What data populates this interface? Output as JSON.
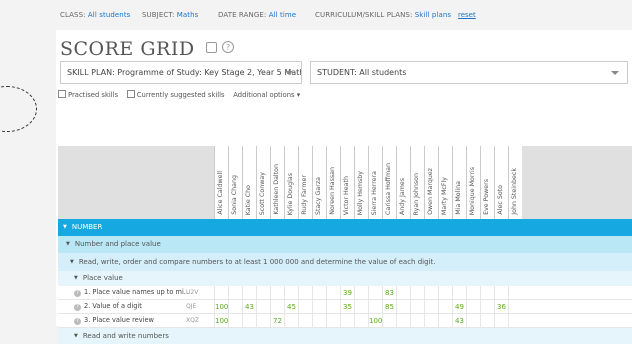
{
  "filters": {
    "class": {
      "label": "CLASS:",
      "value": "All students"
    },
    "subject": {
      "label": "SUBJECT:",
      "value": "Maths"
    },
    "date_range": {
      "label": "DATE RANGE:",
      "value": "All time"
    },
    "plans": {
      "label": "CURRICULUM/SKILL PLANS:",
      "value": "Skill plans"
    },
    "reset": "reset"
  },
  "title": "SCORE GRID",
  "title_icons": [
    "table-icon",
    "help-icon"
  ],
  "help_glyph": "?",
  "skill_plan_select": "SKILL PLAN: Programme of Study: Key Stage 2, Year 5 Math",
  "student_select": "STUDENT: All students",
  "options": {
    "practised": "Practised skills",
    "suggested": "Currently suggested skills",
    "additional": "Additional options"
  },
  "students": [
    "Alice Caldwell",
    "Sonia Chang",
    "Katie Cho",
    "Scott Conway",
    "Kathleen Dalton",
    "Kylie Douglas",
    "Rudy Farmer",
    "Stacy Garza",
    "Noreen Hassan",
    "Victor Heath",
    "Molly Hemsby",
    "Sierra Herrera",
    "Carissa Hoffman",
    "Andy James",
    "Ryan Johnson",
    "Owen Marquez",
    "Marty McFly",
    "Mia Molina",
    "Monique Morris",
    "Eve Powers",
    "Alec Soto",
    "John Steinbeck"
  ],
  "bands": {
    "number": "NUMBER",
    "npv": "Number and place value",
    "objective": "Read, write, order and compare numbers to at least 1 000 000 and determine the value of each digit.",
    "place_value": "Place value",
    "read_write": "Read and write numbers"
  },
  "skills": [
    {
      "name": "1. Place value names up to mi...",
      "code": "U2V",
      "scores": [
        "",
        "",
        "",
        "",
        "",
        "",
        "",
        "",
        "",
        "39",
        "",
        "",
        "83",
        "",
        "",
        "",
        "",
        "",
        "",
        "",
        "",
        ""
      ]
    },
    {
      "name": "2. Value of a digit",
      "code": "QJE",
      "scores": [
        "100",
        "",
        "43",
        "",
        "",
        "45",
        "",
        "",
        "",
        "35",
        "",
        "",
        "85",
        "",
        "",
        "",
        "",
        "49",
        "",
        "",
        "36",
        ""
      ]
    },
    {
      "name": "3. Place value review",
      "code": "XQZ",
      "scores": [
        "100",
        "",
        "",
        "",
        "72",
        "",
        "",
        "",
        "",
        "",
        "",
        "100",
        "",
        "",
        "",
        "",
        "",
        "43",
        "",
        "",
        "",
        ""
      ]
    }
  ],
  "colors": {
    "number_band": "#16a8e0",
    "npv_band": "#b9e7f6",
    "objective_band": "#d4eefa",
    "place_value_band": "#e5f5fb",
    "link": "#1a74c9",
    "score": "#5aaa1e"
  }
}
